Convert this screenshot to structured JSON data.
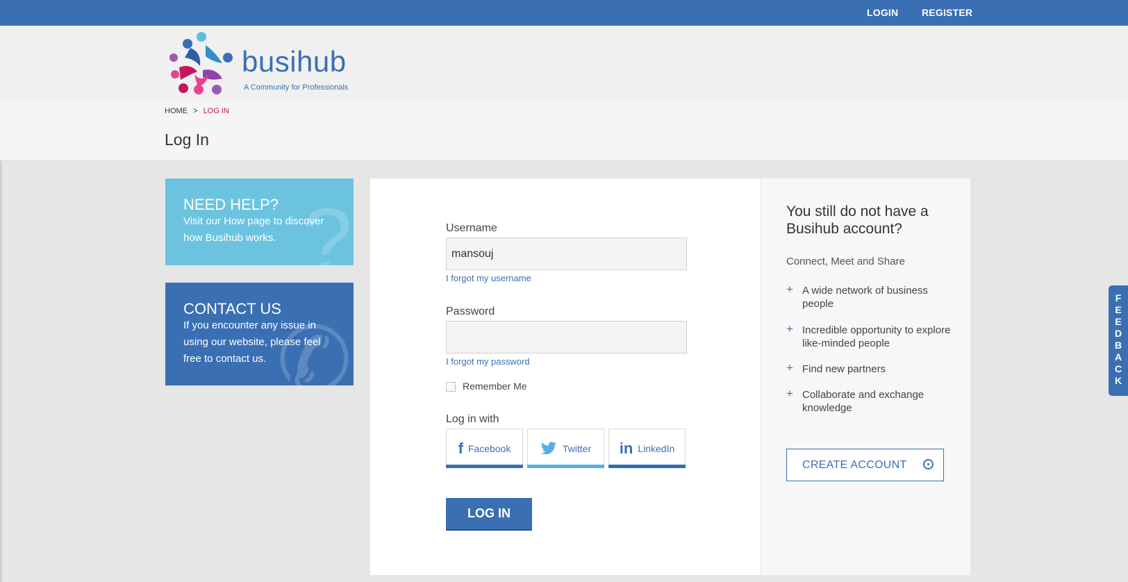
{
  "nav": {
    "login": "LOGIN",
    "register": "REGISTER"
  },
  "brand": {
    "name": "busihub",
    "tagline": "A Community for Professionals"
  },
  "breadcrumb": {
    "home": "HOME",
    "separator": ">",
    "current": "LOG IN"
  },
  "page_title": "Log In",
  "help_card": {
    "title": "NEED HELP?",
    "text": "Visit our How page to discover how Busihub works."
  },
  "contact_card": {
    "title": "CONTACT US",
    "text": "If you encounter any issue in using our website, please feel free to contact us."
  },
  "form": {
    "username_label": "Username",
    "username_value": "mansouj",
    "forgot_username": "I forgot my username",
    "password_label": "Password",
    "password_value": "",
    "forgot_password": "I forgot my password",
    "remember_label": "Remember Me",
    "remember_checked": false,
    "login_with_label": "Log in with",
    "social": [
      {
        "name": "Facebook",
        "icon": "facebook-icon",
        "color": "#3a6fb3"
      },
      {
        "name": "Twitter",
        "icon": "twitter-icon",
        "color": "#5aaee6"
      },
      {
        "name": "LinkedIn",
        "icon": "linkedin-icon",
        "color": "#2b6eb2"
      }
    ],
    "login_button": "LOG IN"
  },
  "signup": {
    "title": "You still do not have a Busihub account?",
    "subtitle": "Connect, Meet and Share",
    "benefits": [
      "A wide network of business people",
      "Incredible opportunity to explore like-minded people",
      "Find new partners",
      "Collaborate and exchange knowledge"
    ],
    "create_button": "CREATE ACCOUNT"
  },
  "feedback_tab": "FEEDBACK",
  "colors": {
    "primary": "#3a6fb3",
    "help": "#6cc3e0",
    "accent": "#c2185b"
  }
}
